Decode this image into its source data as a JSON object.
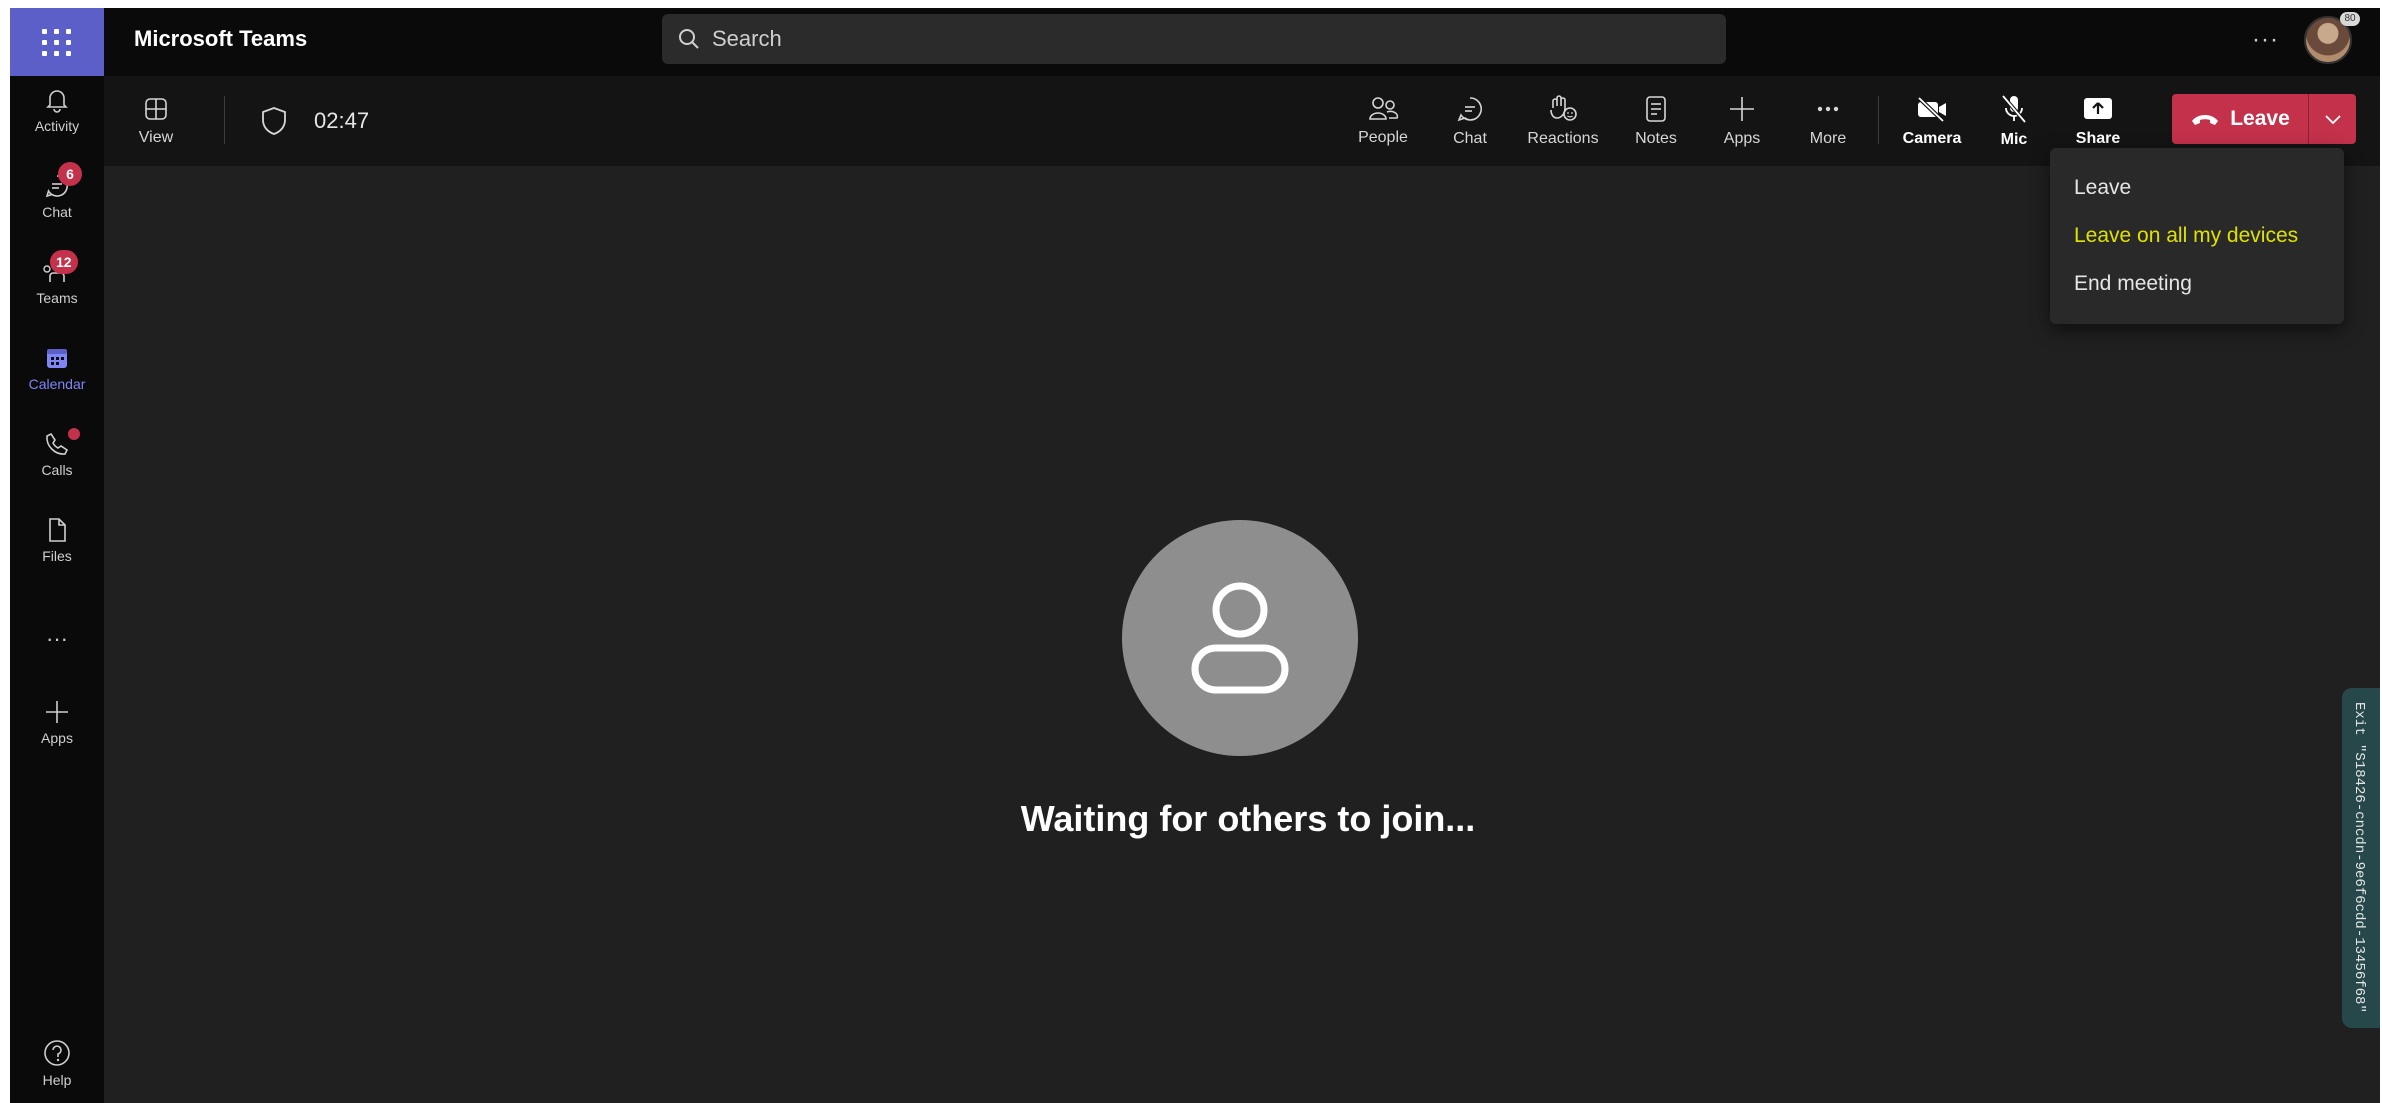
{
  "app": {
    "title": "Microsoft Teams"
  },
  "search": {
    "placeholder": "Search"
  },
  "topbar": {
    "more_label": "···",
    "avatar_badge": "80"
  },
  "rail": {
    "items": [
      {
        "label": "Activity"
      },
      {
        "label": "Chat",
        "badge": "6"
      },
      {
        "label": "Teams",
        "badge": "12"
      },
      {
        "label": "Calendar",
        "active": true
      },
      {
        "label": "Calls"
      },
      {
        "label": "Files"
      },
      {
        "label": "···"
      },
      {
        "label": "Apps"
      }
    ],
    "help_label": "Help"
  },
  "meeting": {
    "timer": "02:47",
    "toolbar": {
      "view": "View",
      "people": "People",
      "chat": "Chat",
      "reactions": "Reactions",
      "notes": "Notes",
      "apps": "Apps",
      "more": "More",
      "camera": "Camera",
      "mic": "Mic",
      "share": "Share",
      "leave": "Leave"
    },
    "leave_menu": [
      "Leave",
      "Leave on all my devices",
      "End meeting"
    ],
    "waiting_text": "Waiting for others to join...",
    "side_tab_text": "Exit \"S18426-cncdn-9e6f6cdd-13456f68\""
  },
  "colors": {
    "brand": "#5b5fc7",
    "leave_red": "#c4314b",
    "highlight": "#e0e100",
    "stage_bg": "#202020"
  }
}
